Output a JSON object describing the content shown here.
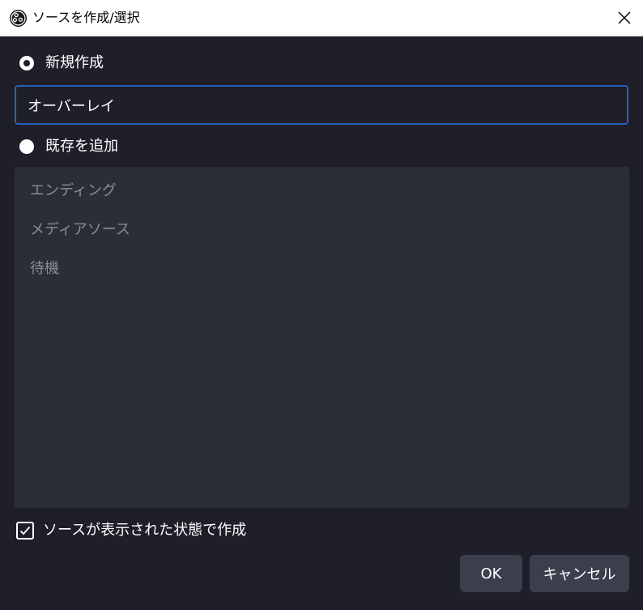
{
  "window": {
    "title": "ソースを作成/選択",
    "app_icon": "obs-logo-icon",
    "close_icon": "close-icon"
  },
  "create_new": {
    "label": "新規作成",
    "selected": true,
    "name_value": "オーバーレイ"
  },
  "add_existing": {
    "label": "既存を追加",
    "selected": false,
    "items": [
      "エンディング",
      "メディアソース",
      "待機"
    ]
  },
  "visible_option": {
    "label": "ソースが表示された状態で作成",
    "checked": true
  },
  "buttons": {
    "ok": "OK",
    "cancel": "キャンセル"
  },
  "colors": {
    "background": "#1e1f29",
    "list_background": "#2b2d38",
    "input_border": "#2a5ebf",
    "button": "#3b3e4c"
  }
}
